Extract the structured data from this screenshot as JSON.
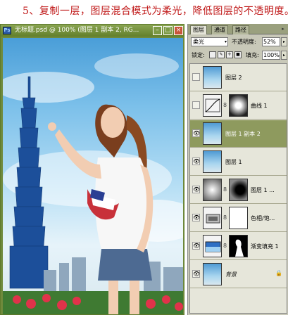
{
  "caption": "5、复制一层，图层混合模式为柔光，降低图层的不透明度。",
  "document": {
    "title": "无标题.psd @ 100% (图层 1 副本 2, RG...",
    "ps_icon": "Ps",
    "min": "–",
    "max": "□",
    "close": "×"
  },
  "panel": {
    "tabs": [
      "图层",
      "通道",
      "路径"
    ],
    "menu": "▸",
    "blend_mode": "柔光",
    "opacity_label": "不透明度:",
    "opacity_value": "52%",
    "lock_label": "锁定:",
    "fill_label": "填充:",
    "fill_value": "100%",
    "arrow": "▸",
    "dropdown_arrow": "▾"
  },
  "layers": [
    {
      "name": "图层 2",
      "visible": false,
      "selected": false,
      "thumb": "photo",
      "mask": false
    },
    {
      "name": "曲线 1",
      "visible": false,
      "selected": false,
      "thumb": "curves",
      "mask": true
    },
    {
      "name": "图层 1 副本 2",
      "visible": true,
      "selected": true,
      "thumb": "photo",
      "mask": false
    },
    {
      "name": "图层 1",
      "visible": true,
      "selected": false,
      "thumb": "photo",
      "mask": false
    },
    {
      "name": "图层 1 ...",
      "visible": true,
      "selected": false,
      "thumb": "gradient-gray",
      "mask": true
    },
    {
      "name": "色相/饱...",
      "visible": true,
      "selected": false,
      "thumb": "hue-sat",
      "mask": true
    },
    {
      "name": "渐变填充 1",
      "visible": true,
      "selected": false,
      "thumb": "gradient-fill",
      "mask": true
    },
    {
      "name": "背景",
      "visible": true,
      "selected": false,
      "thumb": "photo",
      "mask": false,
      "locked": true
    }
  ],
  "icons": {
    "eye": "👁",
    "link": "8",
    "lock": "🔒"
  },
  "colors": {
    "caption": "#c01818",
    "titlebar": "#6f8a3c",
    "selected_layer": "#8e9a5e"
  }
}
